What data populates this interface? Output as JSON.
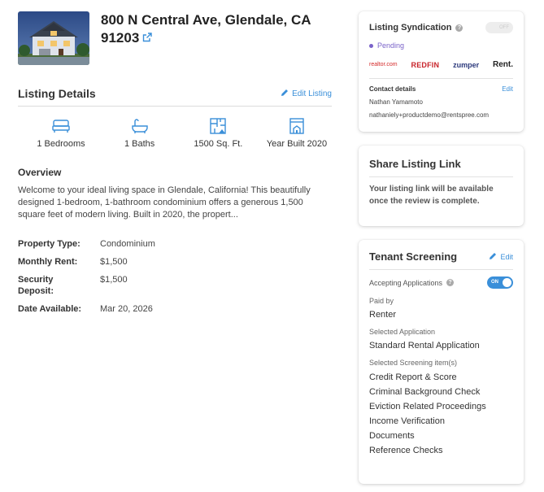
{
  "listing": {
    "address_line1": "800 N Central Ave, Glendale, CA",
    "address_line2": "91203"
  },
  "details": {
    "title": "Listing Details",
    "edit_label": "Edit Listing",
    "features": [
      {
        "icon": "bed-icon",
        "label": "1 Bedrooms"
      },
      {
        "icon": "bath-icon",
        "label": "1 Baths"
      },
      {
        "icon": "floorplan-icon",
        "label": "1500 Sq. Ft."
      },
      {
        "icon": "building-icon",
        "label": "Year Built 2020"
      }
    ],
    "overview_title": "Overview",
    "overview_text": "Welcome to your ideal living space in Glendale, California! This beautifully designed 1-bedroom, 1-bathroom condominium offers a generous 1,500 square feet of modern living. Built in 2020, the propert...",
    "properties": [
      {
        "key": "Property Type:",
        "value": "Condominium"
      },
      {
        "key": "Monthly Rent:",
        "value": "$1,500"
      },
      {
        "key": "Security Deposit:",
        "value": "$1,500"
      },
      {
        "key": "Date Available:",
        "value": "Mar 20, 2026"
      }
    ]
  },
  "syndication": {
    "title": "Listing Syndication",
    "toggle_label": "OFF",
    "status": "Pending",
    "partners": [
      "realtor.com",
      "REDFIN",
      "zumper",
      "Rent."
    ],
    "contact_label": "Contact details",
    "contact_edit": "Edit",
    "contact_name": "Nathan Yamamoto",
    "contact_email": "nathaniely+productdemo@rentspree.com"
  },
  "share": {
    "title": "Share Listing Link",
    "message": "Your listing link will be available once the review is complete."
  },
  "screening": {
    "title": "Tenant Screening",
    "edit_label": "Edit",
    "accepting_label": "Accepting Applications",
    "toggle_label": "ON",
    "paid_by_label": "Paid by",
    "paid_by_value": "Renter",
    "application_label": "Selected Application",
    "application_value": "Standard Rental Application",
    "items_label": "Selected Screening item(s)",
    "items": [
      "Credit Report & Score",
      "Criminal Background Check",
      "Eviction Related Proceedings",
      "Income Verification",
      "Documents",
      "Reference Checks"
    ]
  },
  "colors": {
    "accent": "#3a8fd9",
    "pending": "#7a63c9"
  }
}
